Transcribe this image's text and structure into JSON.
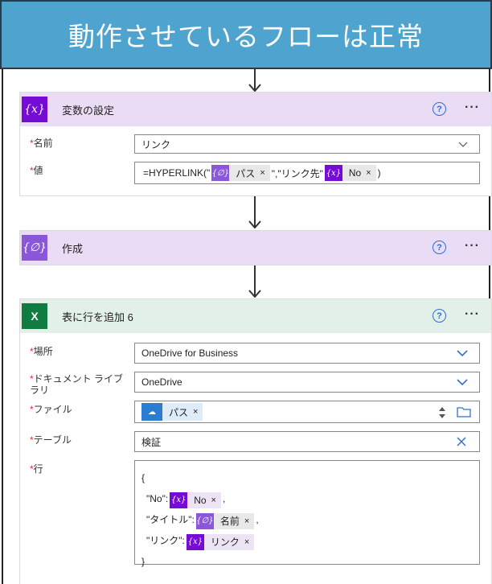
{
  "banner": {
    "title": "動作させているフローは正常"
  },
  "set_variable": {
    "title": "変数の設定",
    "icon": "variable-icon",
    "fields": {
      "name_label": "名前",
      "name_value": "リンク",
      "value_label": "値",
      "value_prefix": "=HYPERLINK(\"",
      "token1": "パス",
      "value_middle": "\",\"リンク先\"",
      "token2": "No",
      "value_suffix": ")"
    }
  },
  "compose": {
    "title": "作成",
    "icon": "expression-icon"
  },
  "add_row": {
    "title": "表に行を追加 6",
    "icon": "excel-icon",
    "fields": {
      "location_label": "場所",
      "location_value": "OneDrive for Business",
      "library_label_1": "ドキュメント ライブ",
      "library_label_2": "ラリ",
      "library_value": "OneDrive",
      "file_label": "ファイル",
      "file_token": "パス",
      "table_label": "テーブル",
      "table_value": "検証",
      "row_label": "行",
      "row_open": "{",
      "row_key1": "\"No\":",
      "row_tok1": "No",
      "row_key2": "\"タイトル\":",
      "row_tok2": "名前",
      "row_key3": "\"リンク\":",
      "row_tok3": "リンク",
      "row_close": "}",
      "comma": ","
    }
  },
  "common": {
    "required_mark": "*",
    "help": "?",
    "more": "···",
    "close": "×"
  },
  "colors": {
    "variable_header": "#eadcf4",
    "excel_header": "#e3f0e8",
    "accent": "#770bd6",
    "banner": "#4fa3cf"
  }
}
